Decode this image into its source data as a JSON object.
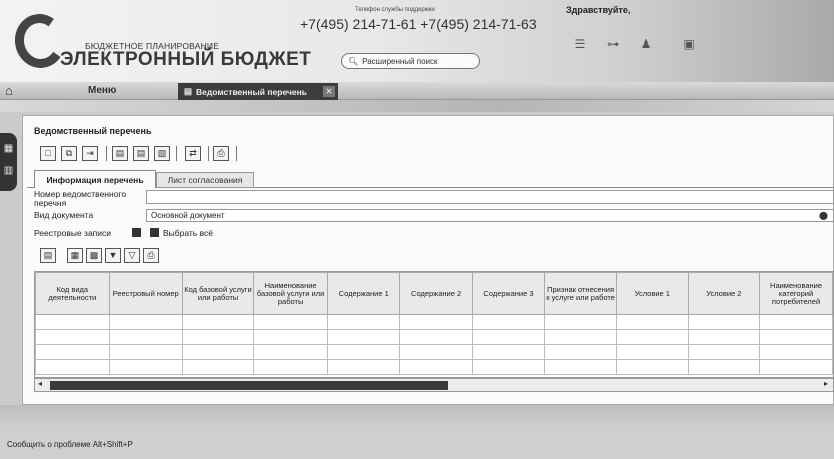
{
  "header": {
    "logo_small": "БЮДЖЕТНОЕ ПЛАНИРОВАНИЕ",
    "logo_big": "ЭЛЕКТРОННЫЙ БЮДЖЕТ",
    "support_label": "Телефон службы поддержки",
    "support_phones": "+7(495) 214-71-61 +7(495) 214-71-63",
    "search_label": "Расширенный поиск",
    "greeting": "Здравствуйте,",
    "icons": [
      "list-icon",
      "hierarchy-icon",
      "users-icon",
      "window-icon"
    ]
  },
  "menubar": {
    "menu_label": "Меню",
    "active_tab": "Ведомственный перечень"
  },
  "panel": {
    "title": "Ведомственный перечень",
    "toolbar_icons": [
      "new-document-icon",
      "copy-document-icon",
      "move-document-icon",
      "document-a-icon",
      "document-b-icon",
      "document-c-icon",
      "export-icon",
      "print-icon"
    ],
    "tabs": [
      "Информация перечень",
      "Лист согласования"
    ],
    "fields": {
      "number_label": "Номер ведомственного перечня",
      "number_value": "",
      "doctype_label": "Вид документа",
      "doctype_value": "Основной документ",
      "records_label": "Реестровые записи",
      "select_all": "Выбрать всё"
    },
    "grid_toolbar_icons": [
      "grid-add-icon",
      "grid-edit-icon",
      "grid-delete-icon",
      "grid-filter-icon",
      "grid-filter-clear-icon",
      "grid-print-icon"
    ],
    "grid": {
      "columns": [
        "Код вида деятельности",
        "Реестровый номер",
        "Код базовой услуги или работы",
        "Наименование базовой услуги или работы",
        "Содержание 1",
        "Содержание 2",
        "Содержание 3",
        "Признак отнесения к услуге или работе",
        "Условие 1",
        "Условие 2",
        "Наименование категорий потребителей"
      ],
      "rows": [
        [
          "",
          "",
          "",
          "",
          "",
          "",
          "",
          "",
          "",
          "",
          ""
        ],
        [
          "",
          "",
          "",
          "",
          "",
          "",
          "",
          "",
          "",
          "",
          ""
        ],
        [
          "",
          "",
          "",
          "",
          "",
          "",
          "",
          "",
          "",
          "",
          ""
        ],
        [
          "",
          "",
          "",
          "",
          "",
          "",
          "",
          "",
          "",
          "",
          ""
        ]
      ]
    }
  },
  "footer": {
    "report_text": "Сообщить о проблеме Alt+Shift+P"
  }
}
